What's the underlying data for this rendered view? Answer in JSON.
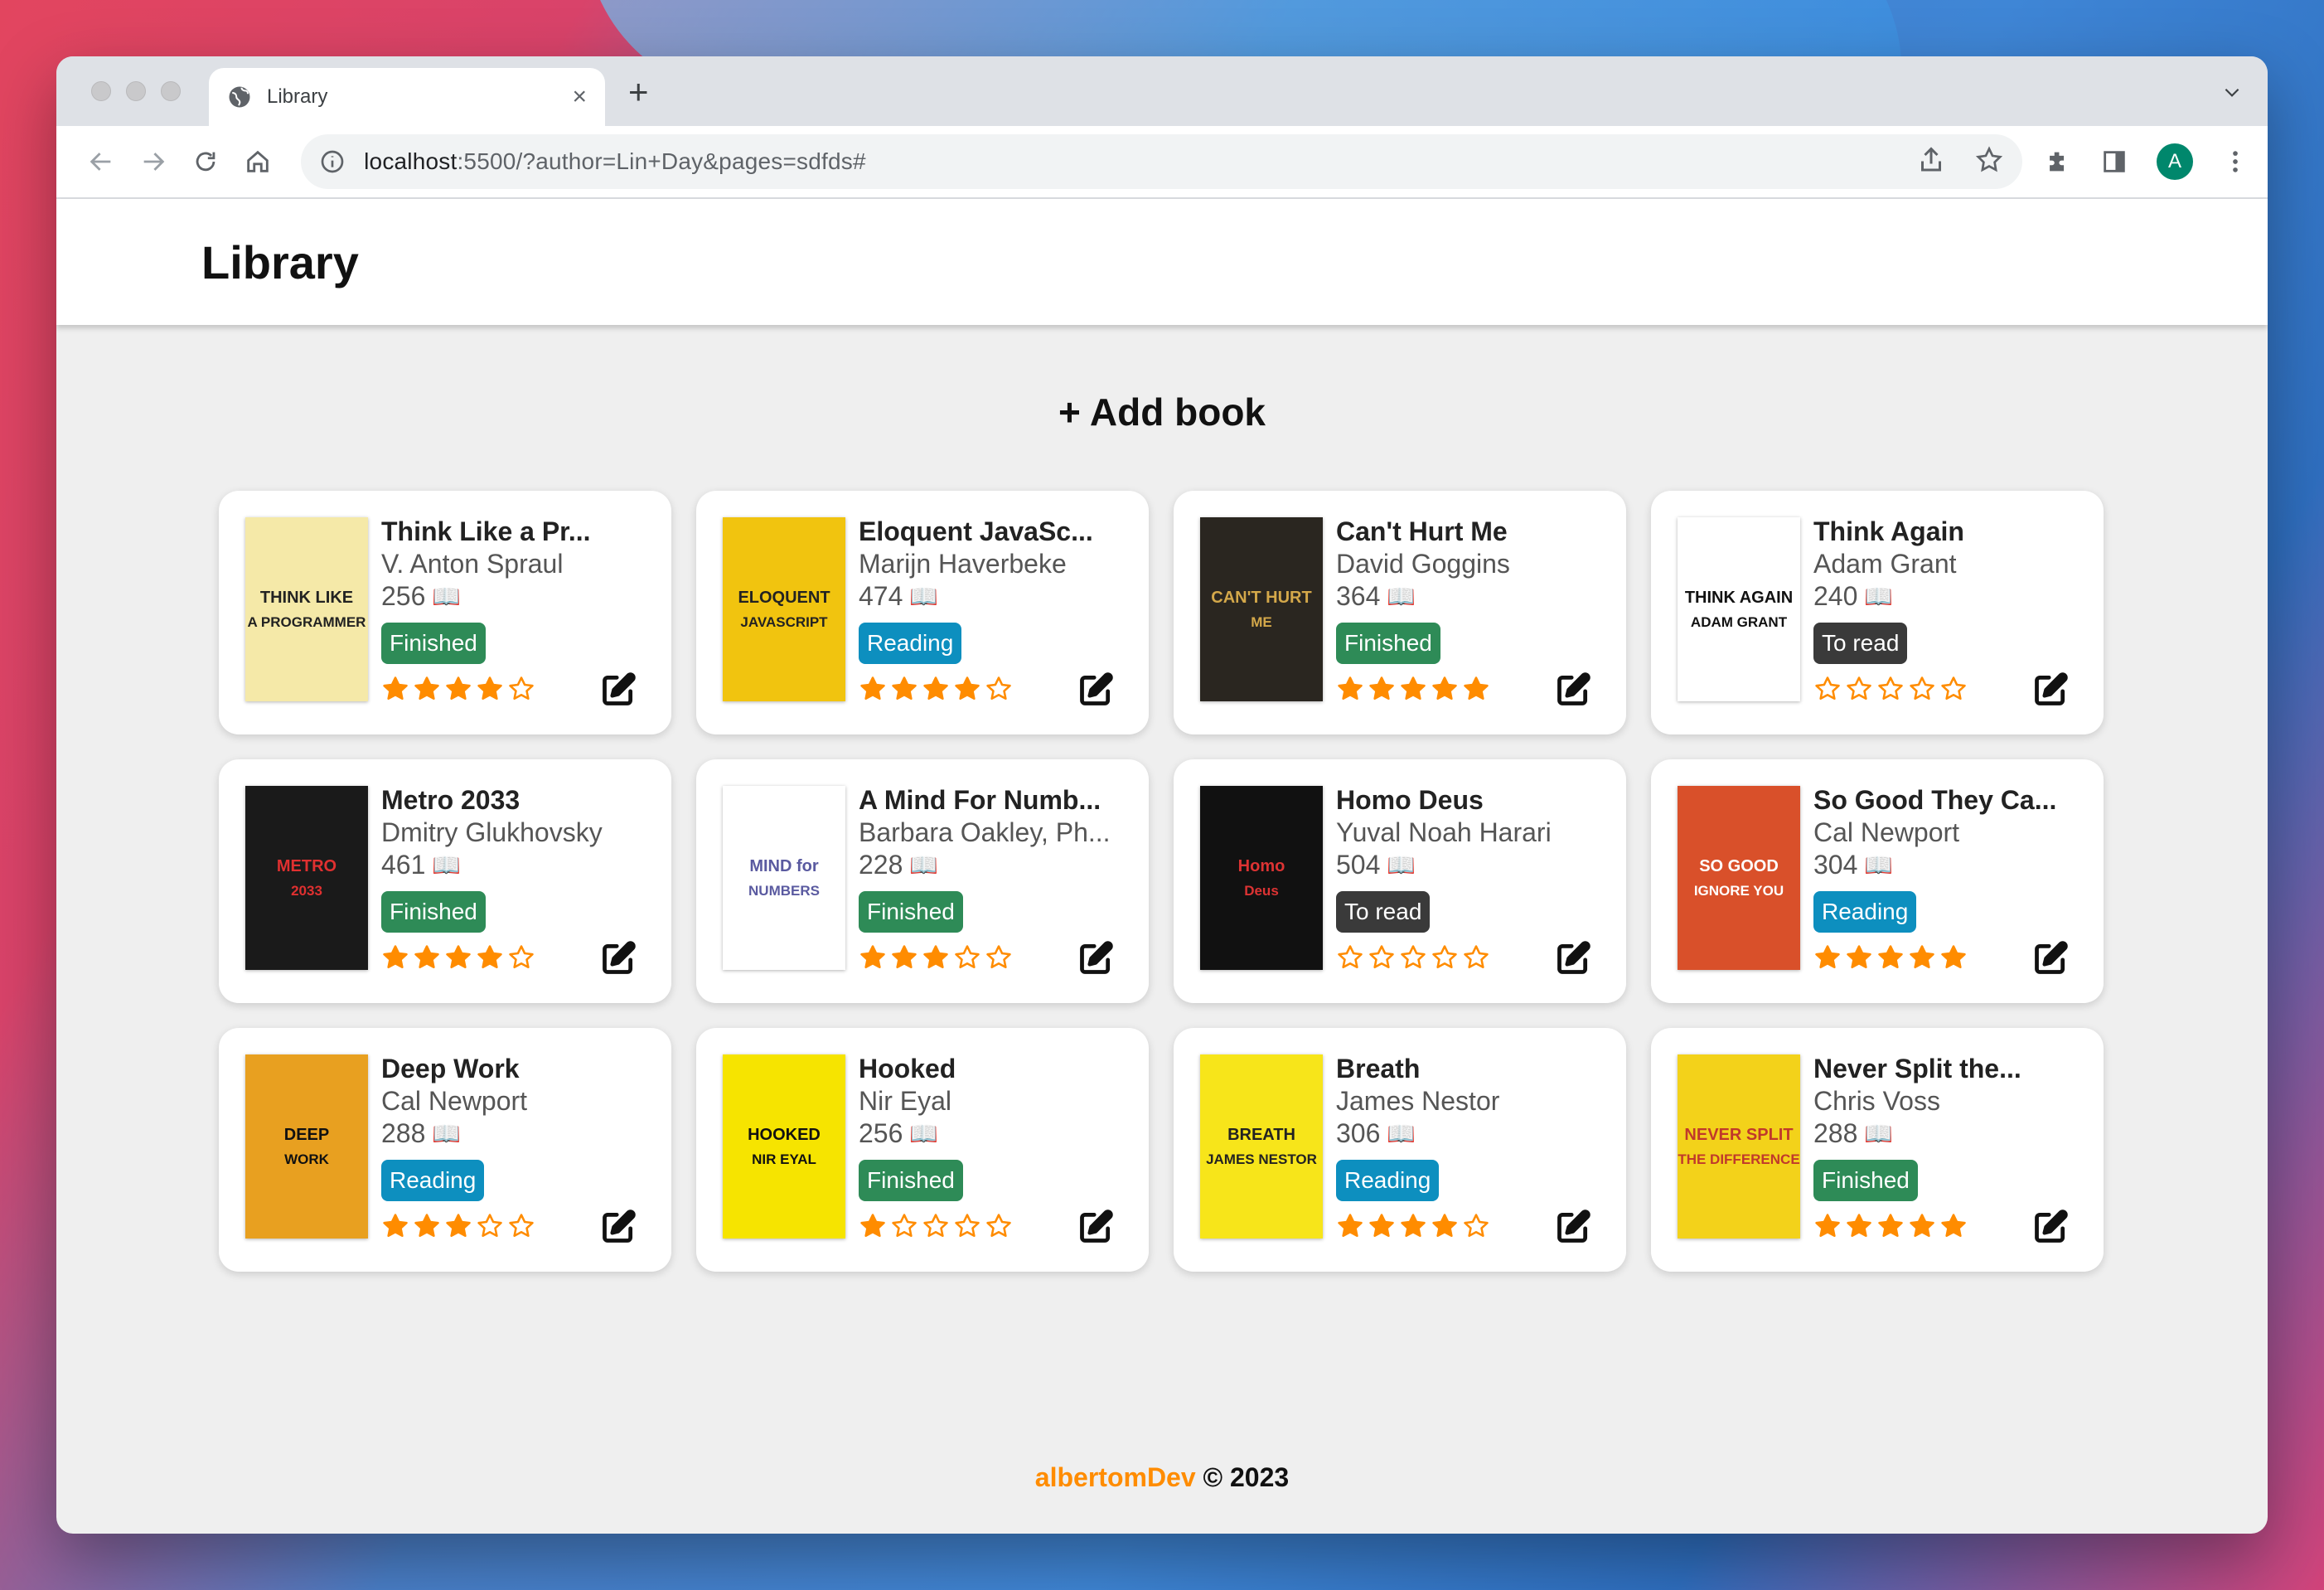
{
  "browser": {
    "tab_title": "Library",
    "url_host": "localhost",
    "url_rest": ":5500/?author=Lin+Day&pages=sdfds#",
    "avatar_letter": "A"
  },
  "page": {
    "title": "Library",
    "add_book_label": "+ Add book",
    "footer_brand": "albertomDev",
    "footer_rest": " © 2023"
  },
  "colors": {
    "finished": "#2e8b57",
    "reading": "#0d8fbf",
    "to_read": "#3a3a3a",
    "star": "#ff8c00",
    "brand": "#ff8c00"
  },
  "books": [
    {
      "title": "Think Like a Pr...",
      "author": "V. Anton Spraul",
      "pages": "256",
      "status": "Finished",
      "rating": 4,
      "cover": {
        "line1": "THINK LIKE",
        "line2": "A PROGRAMMER",
        "bg": "#f5e9a8",
        "fg": "#222"
      }
    },
    {
      "title": "Eloquent JavaSc...",
      "author": "Marijn Haverbeke",
      "pages": "474",
      "status": "Reading",
      "rating": 4,
      "cover": {
        "line1": "ELOQUENT",
        "line2": "JAVASCRIPT",
        "bg": "#f1c40f",
        "fg": "#222"
      }
    },
    {
      "title": "Can't Hurt Me",
      "author": "David Goggins",
      "pages": "364",
      "status": "Finished",
      "rating": 5,
      "cover": {
        "line1": "CAN'T HURT",
        "line2": "ME",
        "bg": "#2a2620",
        "fg": "#d4a84a"
      }
    },
    {
      "title": "Think Again",
      "author": "Adam Grant",
      "pages": "240",
      "status": "To read",
      "rating": 0,
      "cover": {
        "line1": "THINK AGAIN",
        "line2": "ADAM GRANT",
        "bg": "#ffffff",
        "fg": "#111"
      }
    },
    {
      "title": "Metro 2033",
      "author": "Dmitry Glukhovsky",
      "pages": "461",
      "status": "Finished",
      "rating": 4,
      "cover": {
        "line1": "METRO",
        "line2": "2033",
        "bg": "#1a1a1a",
        "fg": "#e03030"
      }
    },
    {
      "title": "A Mind For Numb...",
      "author": "Barbara Oakley, Ph...",
      "pages": "228",
      "status": "Finished",
      "rating": 3,
      "cover": {
        "line1": "MIND for",
        "line2": "NUMBERS",
        "bg": "#ffffff",
        "fg": "#5a5aa0"
      }
    },
    {
      "title": "Homo Deus",
      "author": "Yuval Noah Harari",
      "pages": "504",
      "status": "To read",
      "rating": 0,
      "cover": {
        "line1": "Homo",
        "line2": "Deus",
        "bg": "#111111",
        "fg": "#d33"
      }
    },
    {
      "title": "So Good They Ca...",
      "author": "Cal Newport",
      "pages": "304",
      "status": "Reading",
      "rating": 5,
      "cover": {
        "line1": "SO GOOD",
        "line2": "IGNORE YOU",
        "bg": "#d9502a",
        "fg": "#ffffff"
      }
    },
    {
      "title": "Deep Work",
      "author": "Cal Newport",
      "pages": "288",
      "status": "Reading",
      "rating": 3,
      "cover": {
        "line1": "DEEP",
        "line2": "WORK",
        "bg": "#e8a020",
        "fg": "#111"
      }
    },
    {
      "title": "Hooked",
      "author": "Nir Eyal",
      "pages": "256",
      "status": "Finished",
      "rating": 1,
      "cover": {
        "line1": "HOOKED",
        "line2": "NIR EYAL",
        "bg": "#f6e400",
        "fg": "#111"
      }
    },
    {
      "title": "Breath",
      "author": "James Nestor",
      "pages": "306",
      "status": "Reading",
      "rating": 4,
      "cover": {
        "line1": "BREATH",
        "line2": "JAMES NESTOR",
        "bg": "#f7e51a",
        "fg": "#222"
      }
    },
    {
      "title": "Never Split the...",
      "author": "Chris Voss",
      "pages": "288",
      "status": "Finished",
      "rating": 5,
      "cover": {
        "line1": "NEVER SPLIT",
        "line2": "THE DIFFERENCE",
        "bg": "#f3d21a",
        "fg": "#c0392b"
      }
    }
  ]
}
